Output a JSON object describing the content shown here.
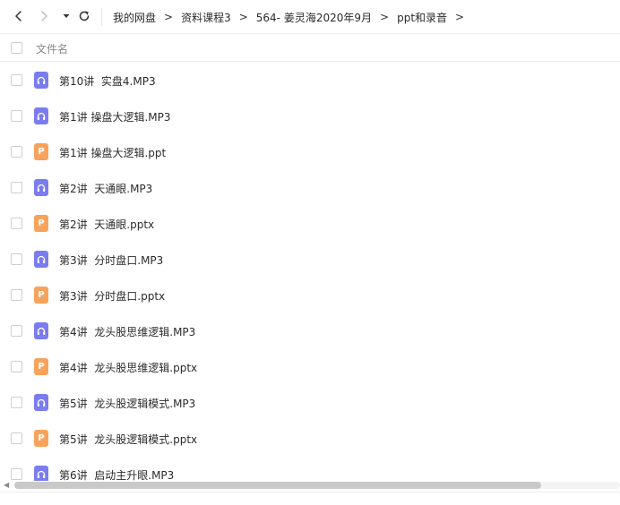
{
  "breadcrumb": [
    {
      "label": "我的网盘"
    },
    {
      "label": "资料课程3"
    },
    {
      "label": "564- 姜灵海2020年9月"
    },
    {
      "label": "ppt和录音"
    }
  ],
  "breadcrumb_separator": ">",
  "list_header": {
    "name_label": "文件名"
  },
  "files": [
    {
      "name": "第10讲  实盘4.MP3",
      "type": "audio"
    },
    {
      "name": "第1讲 操盘大逻辑.MP3",
      "type": "audio"
    },
    {
      "name": "第1讲 操盘大逻辑.ppt",
      "type": "ppt"
    },
    {
      "name": "第2讲  天通眼.MP3",
      "type": "audio"
    },
    {
      "name": "第2讲  天通眼.pptx",
      "type": "ppt"
    },
    {
      "name": "第3讲  分时盘口.MP3",
      "type": "audio"
    },
    {
      "name": "第3讲  分时盘口.pptx",
      "type": "ppt"
    },
    {
      "name": "第4讲  龙头股思维逻辑.MP3",
      "type": "audio"
    },
    {
      "name": "第4讲  龙头股思维逻辑.pptx",
      "type": "ppt"
    },
    {
      "name": "第5讲  龙头股逻辑模式.MP3",
      "type": "audio"
    },
    {
      "name": "第5讲  龙头股逻辑模式.pptx",
      "type": "ppt"
    },
    {
      "name": "第6讲  启动主升眼.MP3",
      "type": "audio"
    }
  ],
  "icons": {
    "audio": {
      "name": "audio-file-icon",
      "color": "#7a7cf0"
    },
    "ppt": {
      "name": "ppt-file-icon",
      "color": "#f7a35c",
      "glyph": "P"
    }
  },
  "scrollbar": {
    "horizontal_thumb_fraction": 0.87
  }
}
